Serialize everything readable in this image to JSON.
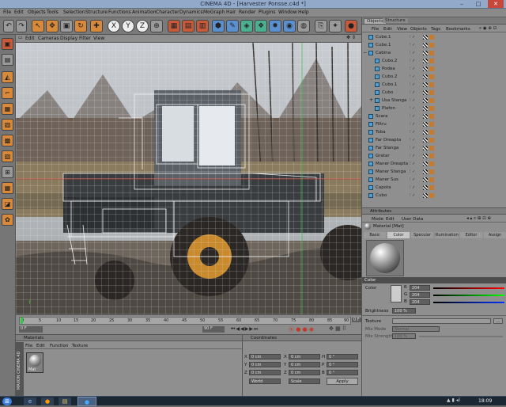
{
  "window": {
    "title": "CINEMA 4D - [Harvester Ponsse.c4d *]",
    "minimize": "–",
    "maximize": "□",
    "close": "✕"
  },
  "menu": [
    "File",
    "Edit",
    "Objects",
    "Tools",
    "Selection",
    "Structure",
    "Functions",
    "Animation",
    "Character",
    "Dynamics",
    "MoGraph",
    "Hair",
    "Render",
    "Plugins",
    "Window",
    "Help"
  ],
  "toolbar": {
    "icons": [
      "undo-icon",
      "redo-icon",
      "live-select-icon",
      "move-icon",
      "scale-icon",
      "rotate-icon",
      "x-axis-icon",
      "y-axis-icon",
      "z-axis-icon",
      "coordinate-system-icon",
      "render-region-icon",
      "render-view-icon",
      "render-settings-icon",
      "cube-icon",
      "spline-pen-icon",
      "subdivision-icon",
      "array-icon",
      "deformer-icon",
      "scene-icon",
      "camera-icon",
      "light-icon"
    ],
    "axis_labels": {
      "x": "X",
      "y": "Y",
      "z": "Z"
    }
  },
  "viewport_menu": [
    "Edit",
    "Cameras",
    "Display",
    "Filter",
    "View"
  ],
  "timeline": {
    "ticks": [
      "0",
      "5",
      "10",
      "15",
      "20",
      "25",
      "30",
      "35",
      "40",
      "45",
      "50",
      "55",
      "60",
      "65",
      "70",
      "75",
      "80",
      "85",
      "90"
    ],
    "current_frame": "0 F",
    "start_field": "0 F",
    "end_field": "90 F",
    "end_label": "0 F"
  },
  "materials": {
    "title": "Materials",
    "menu": [
      "File",
      "Edit",
      "Function",
      "Texture"
    ],
    "swatch_label": "Mat",
    "brand": "MAXON CINEMA 4D"
  },
  "coordinates": {
    "title": "Coordinates",
    "rows": [
      {
        "a": "X",
        "av": "0 cm",
        "b": "X",
        "bv": "0 cm",
        "c": "H",
        "cv": "0 °"
      },
      {
        "a": "Y",
        "av": "0 cm",
        "b": "Y",
        "bv": "0 cm",
        "c": "P",
        "cv": "0 °"
      },
      {
        "a": "Z",
        "av": "0 cm",
        "b": "Z",
        "bv": "0 cm",
        "c": "B",
        "cv": "0 °"
      }
    ],
    "world": "World",
    "scale": "Scale",
    "apply": "Apply"
  },
  "objects_panel": {
    "tabs": [
      "Objects",
      "Structure"
    ],
    "menu": [
      "File",
      "Edit",
      "View",
      "Objects",
      "Tags",
      "Bookmarks"
    ],
    "items": [
      {
        "name": "Cube.1",
        "indent": 0
      },
      {
        "name": "Cube.1",
        "indent": 0
      },
      {
        "name": "Cabina",
        "indent": 0,
        "expand": "−"
      },
      {
        "name": "Cubo.2",
        "indent": 1
      },
      {
        "name": "Podea",
        "indent": 1
      },
      {
        "name": "Cubo.2",
        "indent": 1
      },
      {
        "name": "Cubo.1",
        "indent": 1
      },
      {
        "name": "Cubo",
        "indent": 1
      },
      {
        "name": "Usa Stanga",
        "indent": 1,
        "expand": "+"
      },
      {
        "name": "Plafon",
        "indent": 1
      },
      {
        "name": "Scara",
        "indent": 0
      },
      {
        "name": "Filtru",
        "indent": 0
      },
      {
        "name": "Toba",
        "indent": 0
      },
      {
        "name": "Far Dreapta",
        "indent": 0
      },
      {
        "name": "Far Stanga",
        "indent": 0
      },
      {
        "name": "Gratar",
        "indent": 0
      },
      {
        "name": "Maner Dreapta",
        "indent": 0
      },
      {
        "name": "Maner Stanga",
        "indent": 0
      },
      {
        "name": "Maner Sus",
        "indent": 0
      },
      {
        "name": "Capota",
        "indent": 0
      },
      {
        "name": "Cubo",
        "indent": 0
      }
    ]
  },
  "attributes": {
    "title": "Attributes",
    "menu": [
      "Mode",
      "Edit",
      "User Data"
    ],
    "material_name": "Material [Mat]",
    "tabs": [
      "Basic",
      "Color",
      "Specular",
      "Illumination",
      "Editor",
      "Assign"
    ],
    "active_tab": "Color",
    "color_section": "Color",
    "color_label": "Color",
    "rgb": [
      {
        "ch": "R",
        "val": "204"
      },
      {
        "ch": "G",
        "val": "204"
      },
      {
        "ch": "B",
        "val": "204"
      }
    ],
    "brightness_label": "Brightness",
    "brightness_value": "100 %",
    "texture_label": "Texture",
    "mix_mode_label": "Mix Mode",
    "mix_mode_value": "Normal",
    "mix_strength_label": "Mix Strength",
    "mix_strength_value": "100 %"
  },
  "taskbar": {
    "clock": "18:09",
    "start": "⊞"
  }
}
